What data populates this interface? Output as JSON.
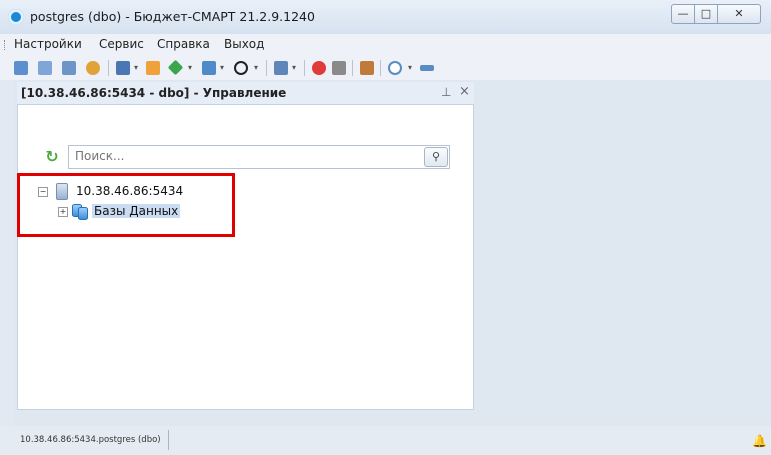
{
  "window": {
    "title": "postgres (dbo) - Бюджет-СМАРТ 21.2.9.1240",
    "buttons": {
      "minimize": "—",
      "maximize": "□",
      "close": "✕"
    }
  },
  "menu": [
    "Настройки",
    "Сервис",
    "Справка",
    "Выход"
  ],
  "toolbar": {
    "icons": [
      "calendar-icon",
      "document-icon",
      "book-icon",
      "users-icon",
      "sql-icon",
      "sql-settings-icon",
      "diamond-icon",
      "export-icon",
      "compass-icon",
      "window-icon",
      "record-icon",
      "scissors-icon",
      "clipboard-icon",
      "clock-icon",
      "link-icon"
    ],
    "dropdown_glyph": "▾"
  },
  "panel": {
    "title": "[10.38.46.86:5434 - dbo] - Управление",
    "pin_glyph": "⊥",
    "close_glyph": "×",
    "search_placeholder": "Поиск...",
    "search_button_glyph": "⚲"
  },
  "tree": {
    "server": {
      "expander": "−",
      "label": "10.38.46.86:5434"
    },
    "databases": {
      "expander": "+",
      "label": "Базы Данных"
    }
  },
  "status": {
    "text": "10.38.46.86:5434.postgres (dbo)"
  },
  "colors": {
    "highlight_box": "#e00000",
    "selection": "#c9dcf2"
  }
}
